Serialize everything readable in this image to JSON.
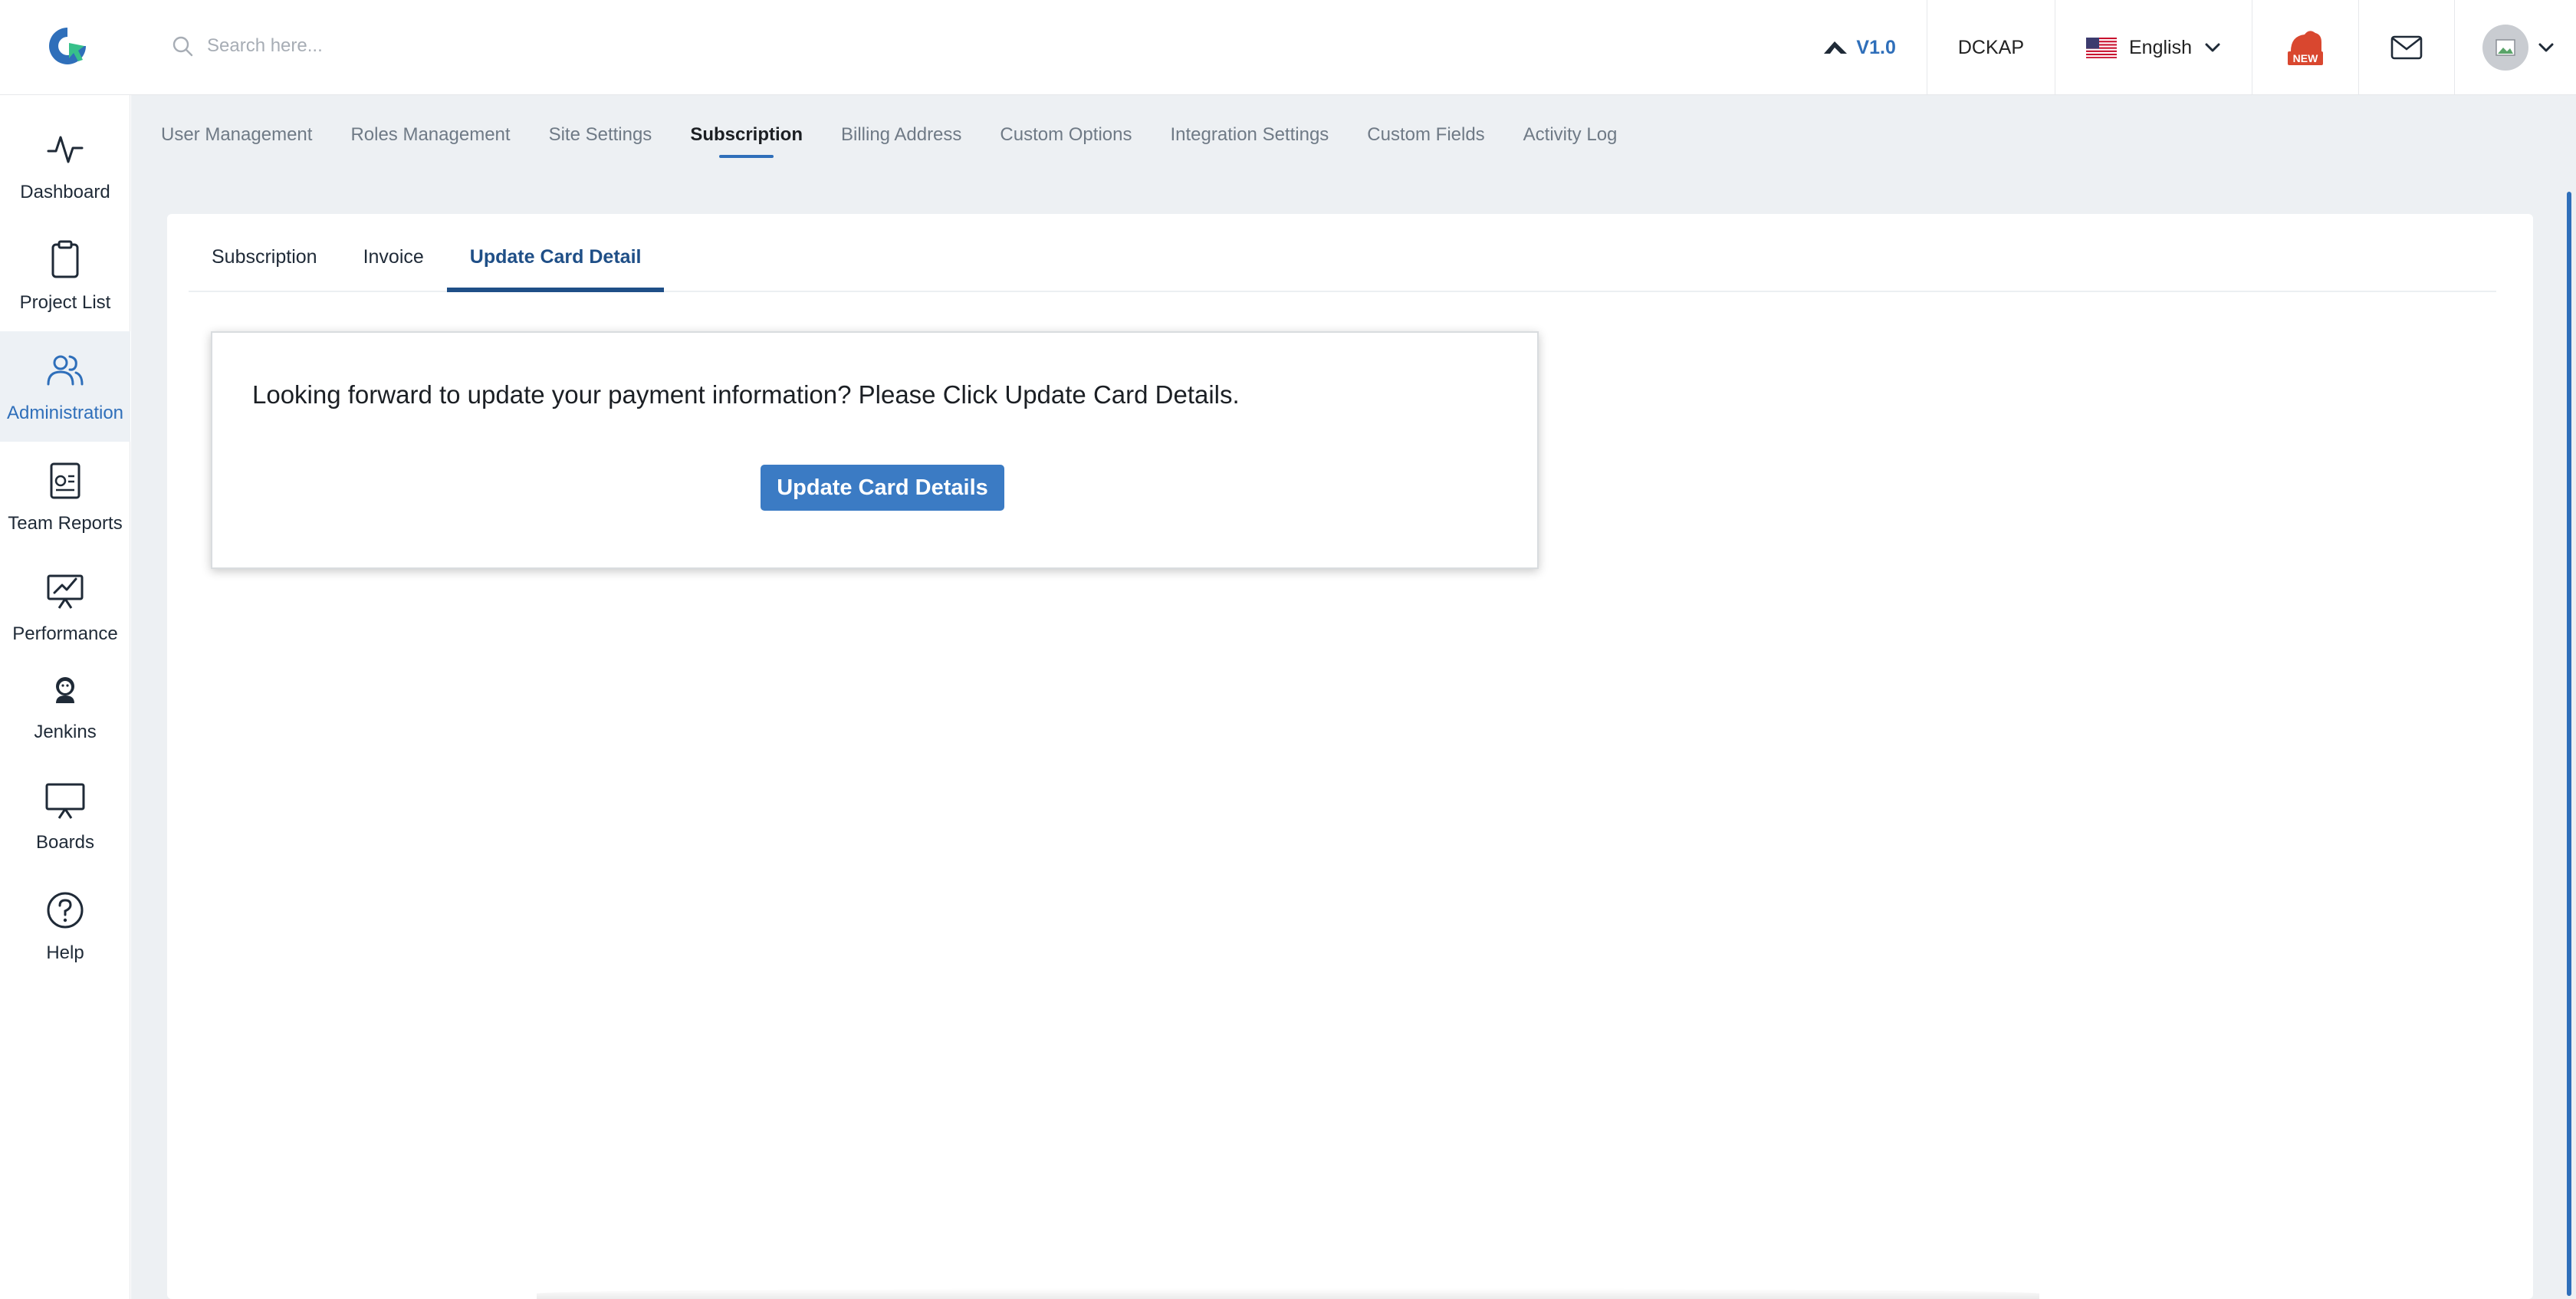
{
  "search": {
    "placeholder": "Search here..."
  },
  "topbar": {
    "version": "V1.0",
    "company": "DCKAP",
    "language": "English",
    "new_badge": "NEW"
  },
  "sidebar": {
    "items": [
      {
        "label": "Dashboard",
        "icon": "activity-icon"
      },
      {
        "label": "Project List",
        "icon": "clipboard-icon"
      },
      {
        "label": "Administration",
        "icon": "users-icon",
        "active": true
      },
      {
        "label": "Team Reports",
        "icon": "report-icon"
      },
      {
        "label": "Performance",
        "icon": "performance-icon"
      },
      {
        "label": "Jenkins",
        "icon": "jenkins-icon"
      },
      {
        "label": "Boards",
        "icon": "board-icon"
      },
      {
        "label": "Help",
        "icon": "help-icon"
      }
    ]
  },
  "admin_tabs": [
    {
      "label": "User Management"
    },
    {
      "label": "Roles Management"
    },
    {
      "label": "Site Settings"
    },
    {
      "label": "Subscription",
      "active": true
    },
    {
      "label": "Billing Address"
    },
    {
      "label": "Custom Options"
    },
    {
      "label": "Integration Settings"
    },
    {
      "label": "Custom Fields"
    },
    {
      "label": "Activity Log"
    }
  ],
  "sub_tabs": [
    {
      "label": "Subscription"
    },
    {
      "label": "Invoice"
    },
    {
      "label": "Update Card Detail",
      "active": true
    }
  ],
  "update_card": {
    "message": "Looking forward to update your payment information? Please Click Update Card Details.",
    "button_label": "Update Card Details"
  },
  "colors": {
    "accent": "#2f6fba",
    "button": "#3b7bc4",
    "active_sub_tab": "#1f4f87",
    "content_bg": "#edf0f3"
  }
}
